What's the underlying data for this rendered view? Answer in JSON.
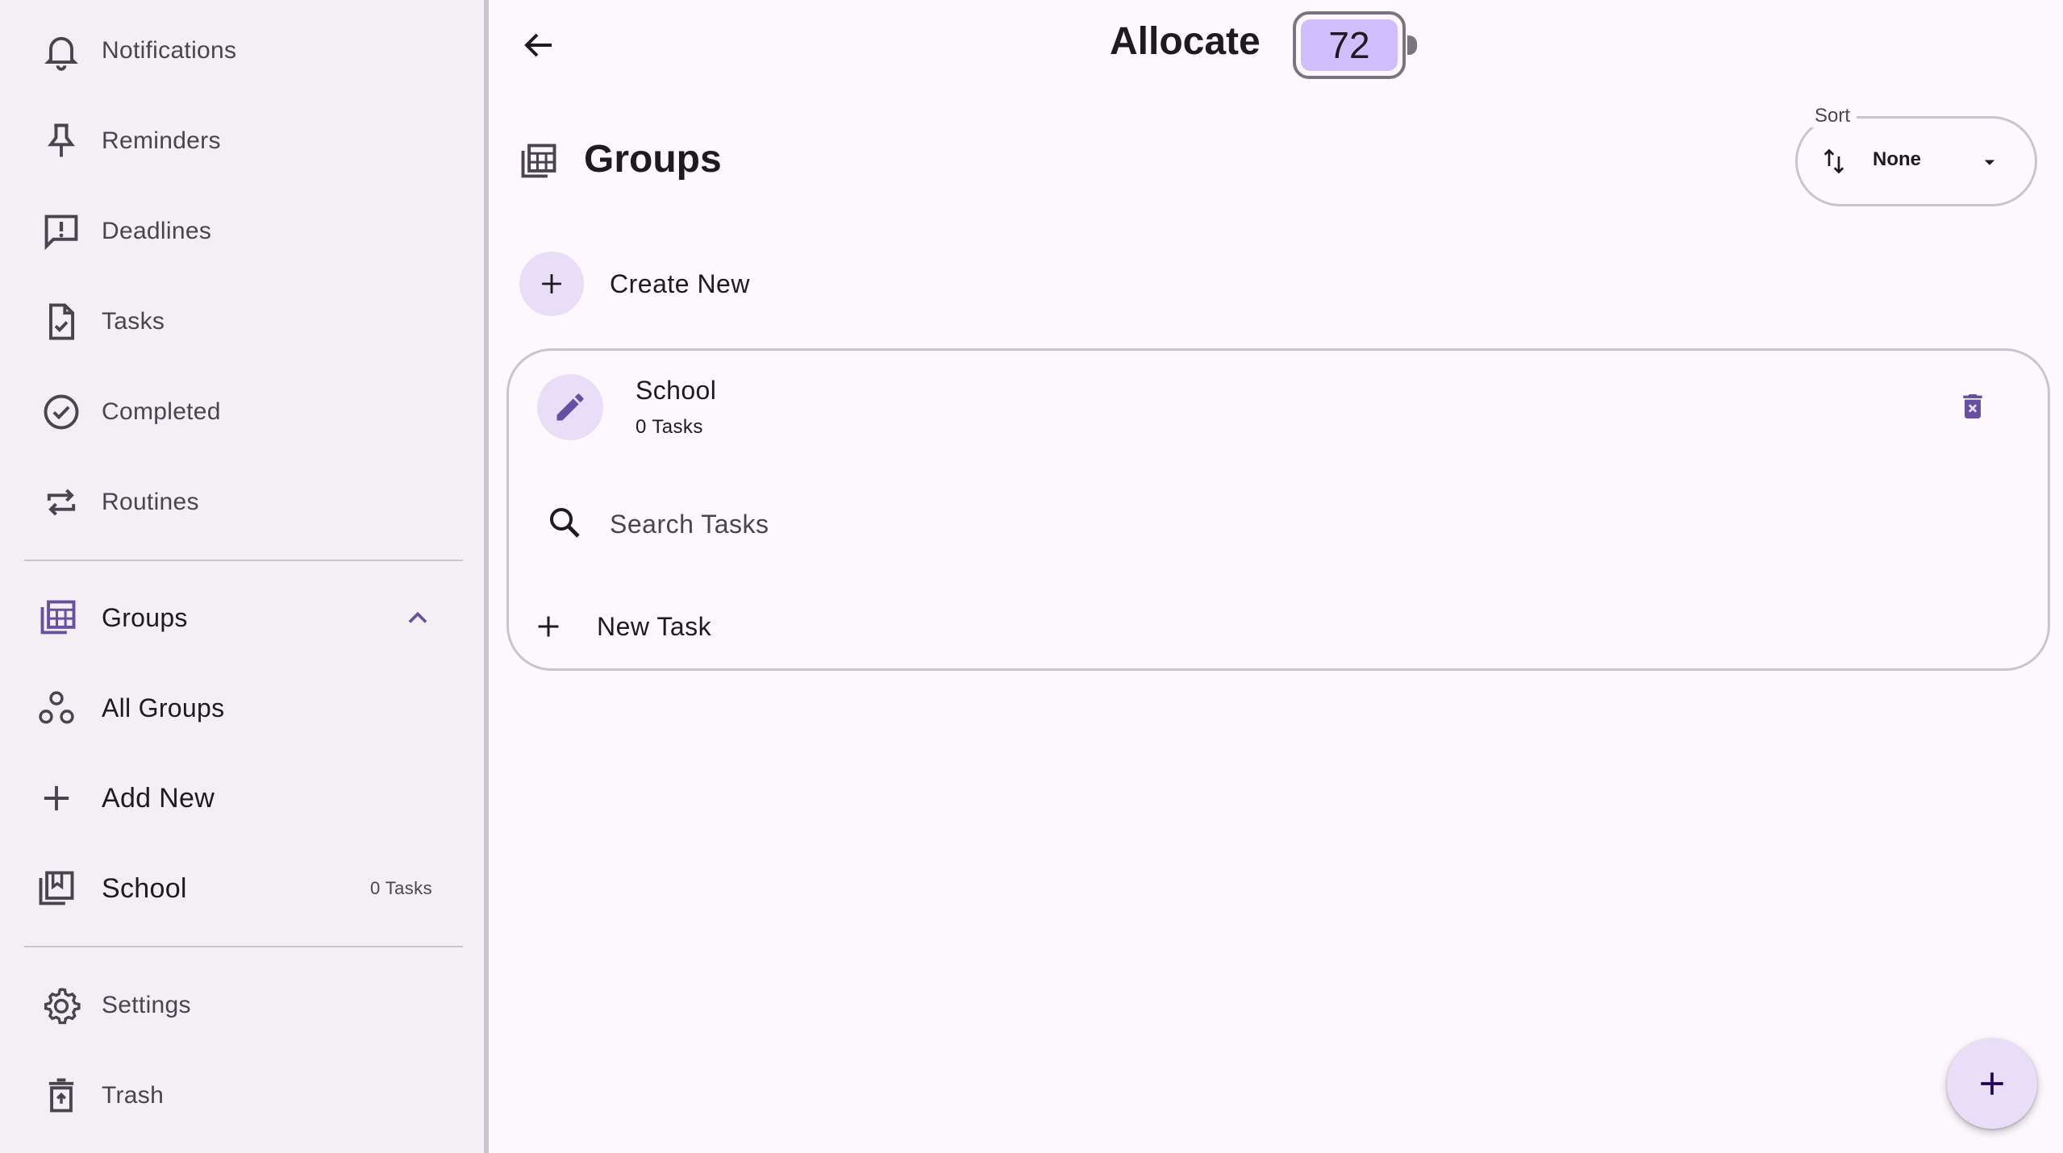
{
  "app": {
    "title": "Allocate",
    "battery_value": "72",
    "accent_color": "#6750a4",
    "container_color": "#e8def8"
  },
  "sidebar": {
    "items": [
      {
        "label": "Notifications",
        "icon": "bell-icon"
      },
      {
        "label": "Reminders",
        "icon": "pin-icon"
      },
      {
        "label": "Deadlines",
        "icon": "feedback-icon"
      },
      {
        "label": "Tasks",
        "icon": "task-file-icon"
      },
      {
        "label": "Completed",
        "icon": "check-circle-icon"
      },
      {
        "label": "Routines",
        "icon": "repeat-icon"
      }
    ],
    "groups_section": {
      "label": "Groups",
      "icon": "groups-stack-icon",
      "expanded": true,
      "children": [
        {
          "label": "All Groups",
          "icon": "bubbles-icon"
        },
        {
          "label": "Add New",
          "icon": "plus-icon"
        },
        {
          "label": "School",
          "icon": "library-books-icon",
          "badge": "0 Tasks"
        }
      ]
    },
    "footer_items": [
      {
        "label": "Settings",
        "icon": "gear-icon"
      },
      {
        "label": "Trash",
        "icon": "trash-icon"
      }
    ]
  },
  "main": {
    "page_title": "Groups",
    "page_icon": "groups-stack-icon",
    "sort": {
      "legend": "Sort",
      "value": "None",
      "icon": "swap-vert-icon"
    },
    "create_new_label": "Create New",
    "group_card": {
      "name": "School",
      "task_count": "0 Tasks",
      "search_placeholder": "Search Tasks",
      "new_task_label": "New Task"
    }
  }
}
